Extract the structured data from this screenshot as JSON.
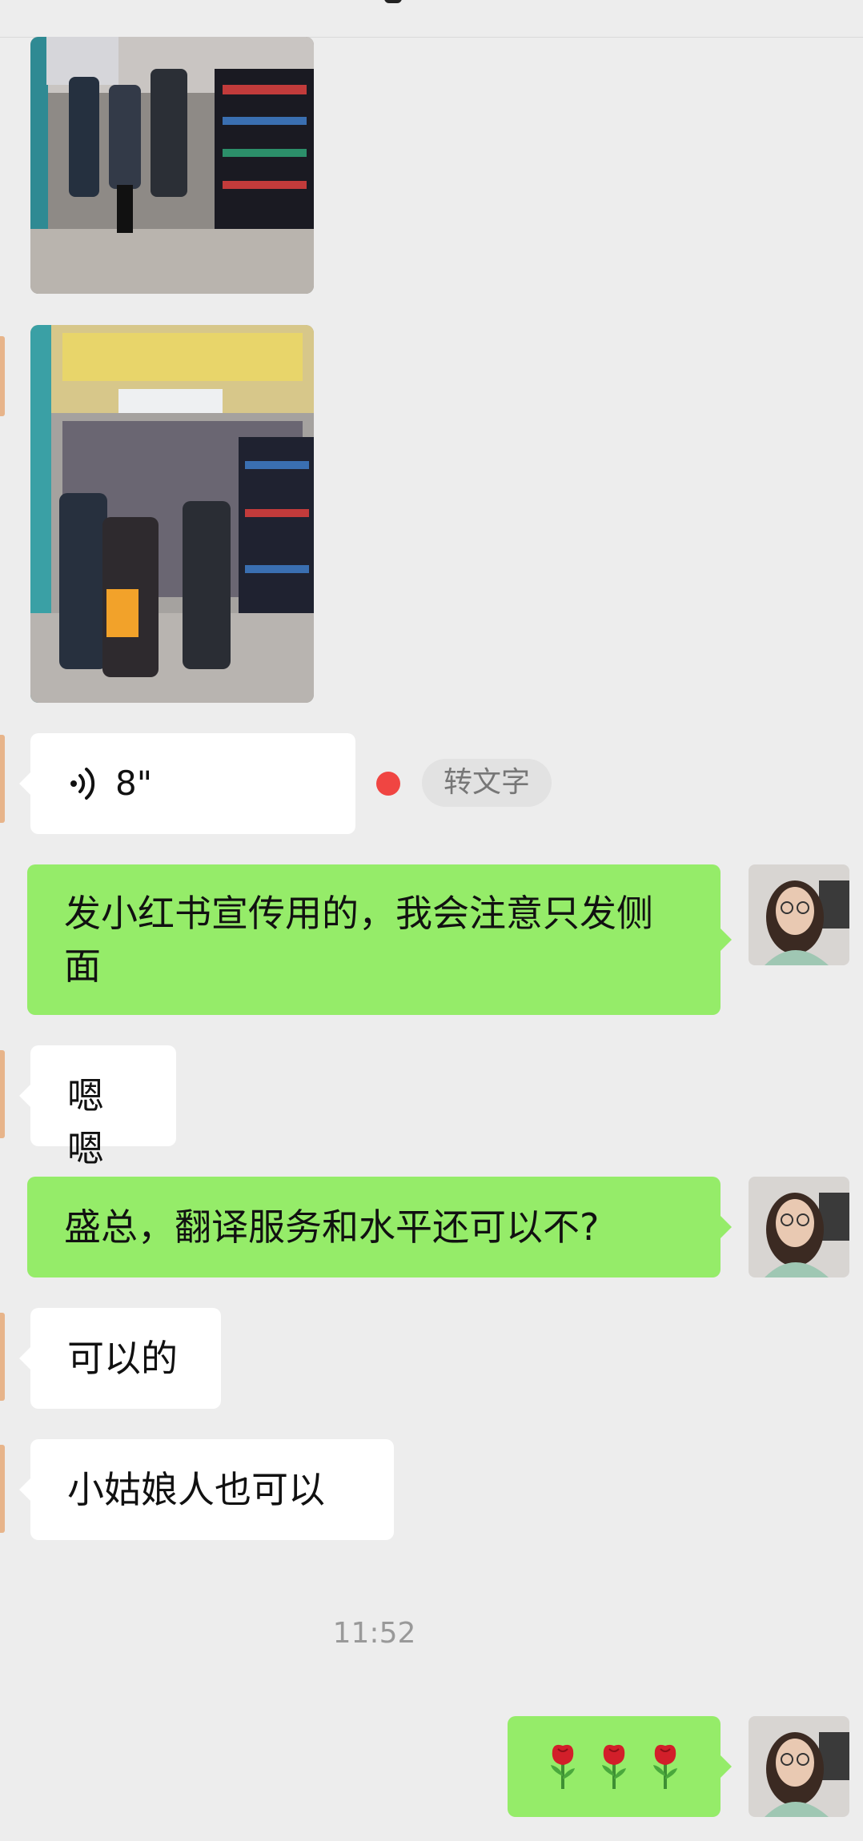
{
  "chat": {
    "voice_message": {
      "duration": "8\"",
      "to_text_label": "转文字"
    },
    "messages": [
      {
        "side": "out",
        "text": "发小红书宣传用的，我会注意只发侧面"
      },
      {
        "side": "in",
        "text": "嗯嗯"
      },
      {
        "side": "out",
        "text": "盛总，翻译服务和水平还可以不?"
      },
      {
        "side": "in",
        "text": "可以的"
      },
      {
        "side": "in",
        "text": "小姑娘人也可以"
      }
    ],
    "timestamp": "11:52",
    "last_message": {
      "side": "out",
      "emoji": "rose",
      "count": 3
    },
    "photos": [
      {
        "desc": "store-photo-1",
        "count": 2
      }
    ]
  },
  "colors": {
    "background": "#ededed",
    "outgoing_bubble": "#95ec69",
    "incoming_bubble": "#ffffff",
    "unread_dot": "#f04542"
  }
}
